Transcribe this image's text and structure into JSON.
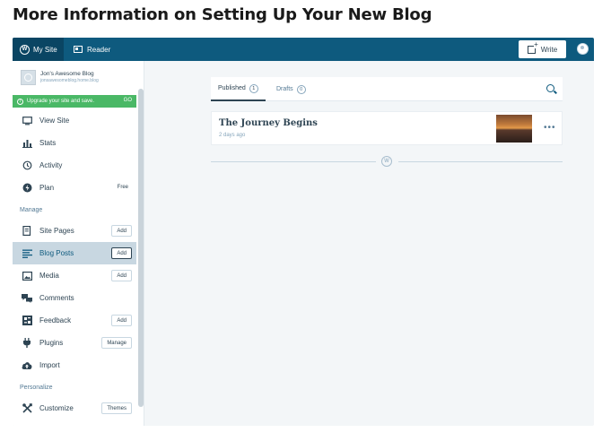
{
  "article": {
    "heading": "More Information on Setting Up Your New Blog"
  },
  "masterbar": {
    "my_site_label": "My Site",
    "reader_label": "Reader",
    "write_label": "Write"
  },
  "sidebar": {
    "site": {
      "title": "Jon's Awesome Blog",
      "url": "jonsawesomeblog.home.blog"
    },
    "upgrade": {
      "text": "Upgrade your site and save.",
      "action": "GO"
    },
    "items_top": [
      {
        "label": "View Site",
        "icon": "monitor-icon"
      },
      {
        "label": "Stats",
        "icon": "bar-chart-icon"
      },
      {
        "label": "Activity",
        "icon": "history-icon"
      },
      {
        "label": "Plan",
        "icon": "plan-icon",
        "value": "Free"
      }
    ],
    "manage_heading": "Manage",
    "manage_items": [
      {
        "label": "Site Pages",
        "icon": "page-icon",
        "button": "Add"
      },
      {
        "label": "Blog Posts",
        "icon": "posts-icon",
        "button": "Add",
        "selected": true
      },
      {
        "label": "Media",
        "icon": "image-icon",
        "button": "Add"
      },
      {
        "label": "Comments",
        "icon": "comments-icon"
      },
      {
        "label": "Feedback",
        "icon": "feedback-icon",
        "button": "Add"
      },
      {
        "label": "Plugins",
        "icon": "plug-icon",
        "button": "Manage"
      },
      {
        "label": "Import",
        "icon": "cloud-upload-icon"
      }
    ],
    "personalize_heading": "Personalize",
    "personalize_items": [
      {
        "label": "Customize",
        "icon": "tools-icon",
        "button": "Themes"
      }
    ]
  },
  "posts": {
    "tabs": [
      {
        "label": "Published",
        "count": "1",
        "selected": true
      },
      {
        "label": "Drafts",
        "count": "0",
        "selected": false
      }
    ],
    "items": [
      {
        "title": "The Journey Begins",
        "meta": "2 days ago"
      }
    ]
  },
  "colors": {
    "masterbar": "#0e5a7e",
    "upgrade": "#4ab866",
    "selected_nav": "#c8d7e1",
    "text": "#2e4453"
  }
}
